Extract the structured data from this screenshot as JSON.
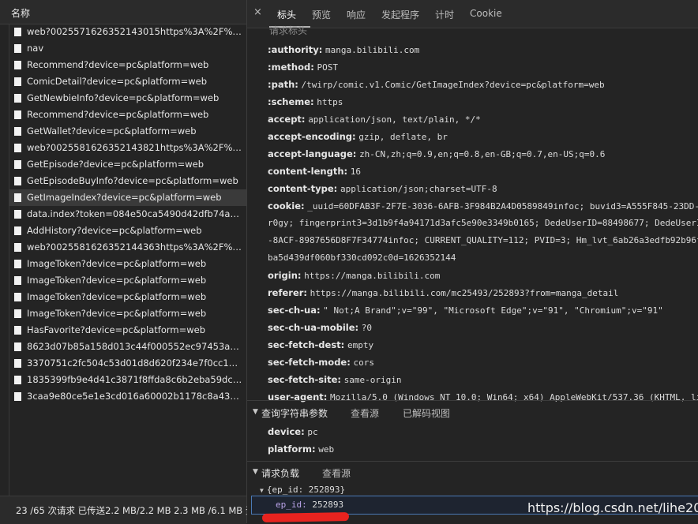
{
  "left_panel": {
    "column_header": "名称",
    "requests": [
      "web?0025571626352143015https%3A%2F%2Fma…",
      "nav",
      "Recommend?device=pc&platform=web",
      "ComicDetail?device=pc&platform=web",
      "GetNewbieInfo?device=pc&platform=web",
      "Recommend?device=pc&platform=web",
      "GetWallet?device=pc&platform=web",
      "web?0025581626352143821https%3A%2F%2Fma…",
      "GetEpisode?device=pc&platform=web",
      "GetEpisodeBuyInfo?device=pc&platform=web",
      "GetImageIndex?device=pc&platform=web",
      "data.index?token=084e50ca5490d42dfb74a3bc2a…",
      "AddHistory?device=pc&platform=web",
      "web?0025581626352144363https%3A%2F%2Fma…",
      "ImageToken?device=pc&platform=web",
      "ImageToken?device=pc&platform=web",
      "ImageToken?device=pc&platform=web",
      "ImageToken?device=pc&platform=web",
      "HasFavorite?device=pc&platform=web",
      "8623d07b85a158d013c44f000552ec97453a634f.jp…",
      "3370751c2fc504c53d01d8d620f234e7f0cc116b.jp…",
      "1835399fb9e4d41c3871f8ffda8c6b2eba59dcaa.jp…",
      "3caa9e80ce5e1e3cd016a60002b1178c8a438cb2.j…"
    ],
    "selected_index": 10,
    "status_bar": "23 /65 次请求  已传送2.2 MB/2.2 MB  2.3 MB /6.1 MB 资"
  },
  "tabs": {
    "close": "×",
    "items": [
      "标头",
      "预览",
      "响应",
      "发起程序",
      "计时",
      "Cookie"
    ],
    "active_index": 0
  },
  "request_headers": {
    "partial_title": "请求标头",
    "rows": [
      {
        "key": ":authority:",
        "value": "manga.bilibili.com"
      },
      {
        "key": ":method:",
        "value": "POST"
      },
      {
        "key": ":path:",
        "value": "/twirp/comic.v1.Comic/GetImageIndex?device=pc&platform=web"
      },
      {
        "key": ":scheme:",
        "value": "https"
      },
      {
        "key": "accept:",
        "value": "application/json, text/plain, */*"
      },
      {
        "key": "accept-encoding:",
        "value": "gzip, deflate, br"
      },
      {
        "key": "accept-language:",
        "value": "zh-CN,zh;q=0.9,en;q=0.8,en-GB;q=0.7,en-US;q=0.6"
      },
      {
        "key": "content-length:",
        "value": "16"
      },
      {
        "key": "content-type:",
        "value": "application/json;charset=UTF-8"
      },
      {
        "key": "cookie:",
        "value": "_uuid=60DFAB3F-2F7E-3036-6AFB-3F984B2A4D0589849infoc; buvid3=A555F845-23DD-4"
      }
    ],
    "cookie_continuation": [
      "r0gy; fingerprint3=3d1b9f4a94171d3afc5e90e3349b0165; DedeUserID=88498677; DedeUserI",
      "-8ACF-8987656D8F7F34774infoc; CURRENT_QUALITY=112; PVID=3; Hm_lvt_6ab26a3edfb92b96f",
      "ba5d439df060bf330cd092c0d=1626352144"
    ],
    "rows2": [
      {
        "key": "origin:",
        "value": "https://manga.bilibili.com"
      },
      {
        "key": "referer:",
        "value": "https://manga.bilibili.com/mc25493/252893?from=manga_detail"
      },
      {
        "key": "sec-ch-ua:",
        "value": "\" Not;A Brand\";v=\"99\", \"Microsoft Edge\";v=\"91\", \"Chromium\";v=\"91\""
      },
      {
        "key": "sec-ch-ua-mobile:",
        "value": "?0"
      },
      {
        "key": "sec-fetch-dest:",
        "value": "empty"
      },
      {
        "key": "sec-fetch-mode:",
        "value": "cors"
      },
      {
        "key": "sec-fetch-site:",
        "value": "same-origin"
      },
      {
        "key": "user-agent:",
        "value": "Mozilla/5.0 (Windows NT 10.0; Win64; x64) AppleWebKit/537.36 (KHTML, lik"
      }
    ]
  },
  "query_params": {
    "title": "查询字符串参数",
    "view_source": "查看源",
    "view_decoded": "已解码视图",
    "rows": [
      {
        "key": "device:",
        "value": "pc"
      },
      {
        "key": "platform:",
        "value": "web"
      }
    ]
  },
  "payload": {
    "title": "请求负载",
    "view_source": "查看源",
    "root": "{ep_id: 252893}",
    "child_key": "ep_id:",
    "child_value": "252893"
  },
  "watermark": "https://blog.csdn.net/lihe2007"
}
